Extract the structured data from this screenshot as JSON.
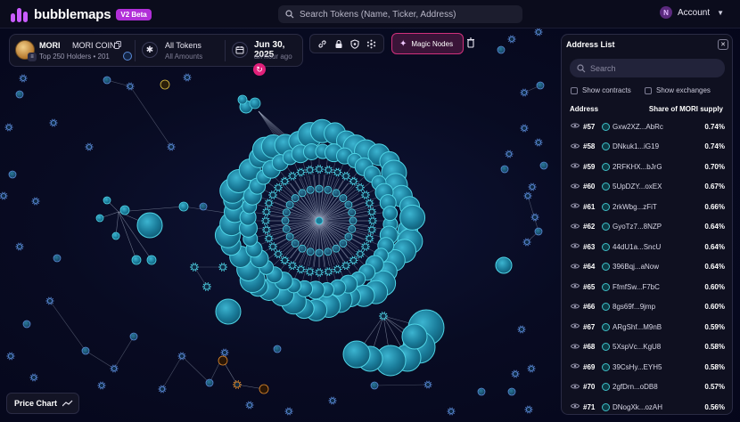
{
  "app": {
    "name": "bubblemaps",
    "version_badge": "V2 Beta"
  },
  "header": {
    "search_placeholder": "Search Tokens (Name, Ticker, Address)",
    "account_initial": "N",
    "account_label": "Account"
  },
  "token": {
    "symbol": "MORI",
    "name": "MORI COIN",
    "subtitle": "Top 250 Holders • 201",
    "filter_title": "All Tokens",
    "filter_sub": "All Amounts",
    "date": "Jun 30, 2025",
    "date_ago": "an hour ago"
  },
  "toolbar": {
    "tools": [
      "link-icon",
      "lock-icon",
      "shield-icon",
      "sparkle-icon"
    ],
    "magic_nodes_label": "Magic Nodes"
  },
  "address_list": {
    "title": "Address List",
    "search_placeholder": "Search",
    "show_contracts_label": "Show contracts",
    "show_exchanges_label": "Show exchanges",
    "col_address": "Address",
    "col_share": "Share of MORI supply",
    "rows": [
      {
        "rank": "#57",
        "address": "Gxw2XZ...AbRc",
        "share": "0.74%"
      },
      {
        "rank": "#58",
        "address": "DNkuk1...iG19",
        "share": "0.74%"
      },
      {
        "rank": "#59",
        "address": "2RFKHX...bJrG",
        "share": "0.70%"
      },
      {
        "rank": "#60",
        "address": "5UpDZY...oxEX",
        "share": "0.67%"
      },
      {
        "rank": "#61",
        "address": "2rkWbg...zFiT",
        "share": "0.66%"
      },
      {
        "rank": "#62",
        "address": "GyoTz7...8NZP",
        "share": "0.64%"
      },
      {
        "rank": "#63",
        "address": "44dU1a...SncU",
        "share": "0.64%"
      },
      {
        "rank": "#64",
        "address": "396Bqj...aNow",
        "share": "0.64%"
      },
      {
        "rank": "#65",
        "address": "FfmfSw...F7bC",
        "share": "0.60%"
      },
      {
        "rank": "#66",
        "address": "8gs69f...9jmp",
        "share": "0.60%"
      },
      {
        "rank": "#67",
        "address": "ARgShf...M9nB",
        "share": "0.59%"
      },
      {
        "rank": "#68",
        "address": "5XspVc...KgU8",
        "share": "0.58%"
      },
      {
        "rank": "#69",
        "address": "39CsHy...EYH5",
        "share": "0.58%"
      },
      {
        "rank": "#70",
        "address": "2gfDrn...oDB8",
        "share": "0.57%"
      },
      {
        "rank": "#71",
        "address": "DNogXk...ozAH",
        "share": "0.56%"
      }
    ]
  },
  "price_chart": {
    "label": "Price Chart"
  },
  "colors": {
    "accent": "#c95cff",
    "magic": "#d0307c",
    "bubble_fill": "#1e8aa8",
    "bubble_stroke": "#4fd4e6",
    "orange_node": "#e08a2c",
    "yellow_node": "#e0c040"
  }
}
